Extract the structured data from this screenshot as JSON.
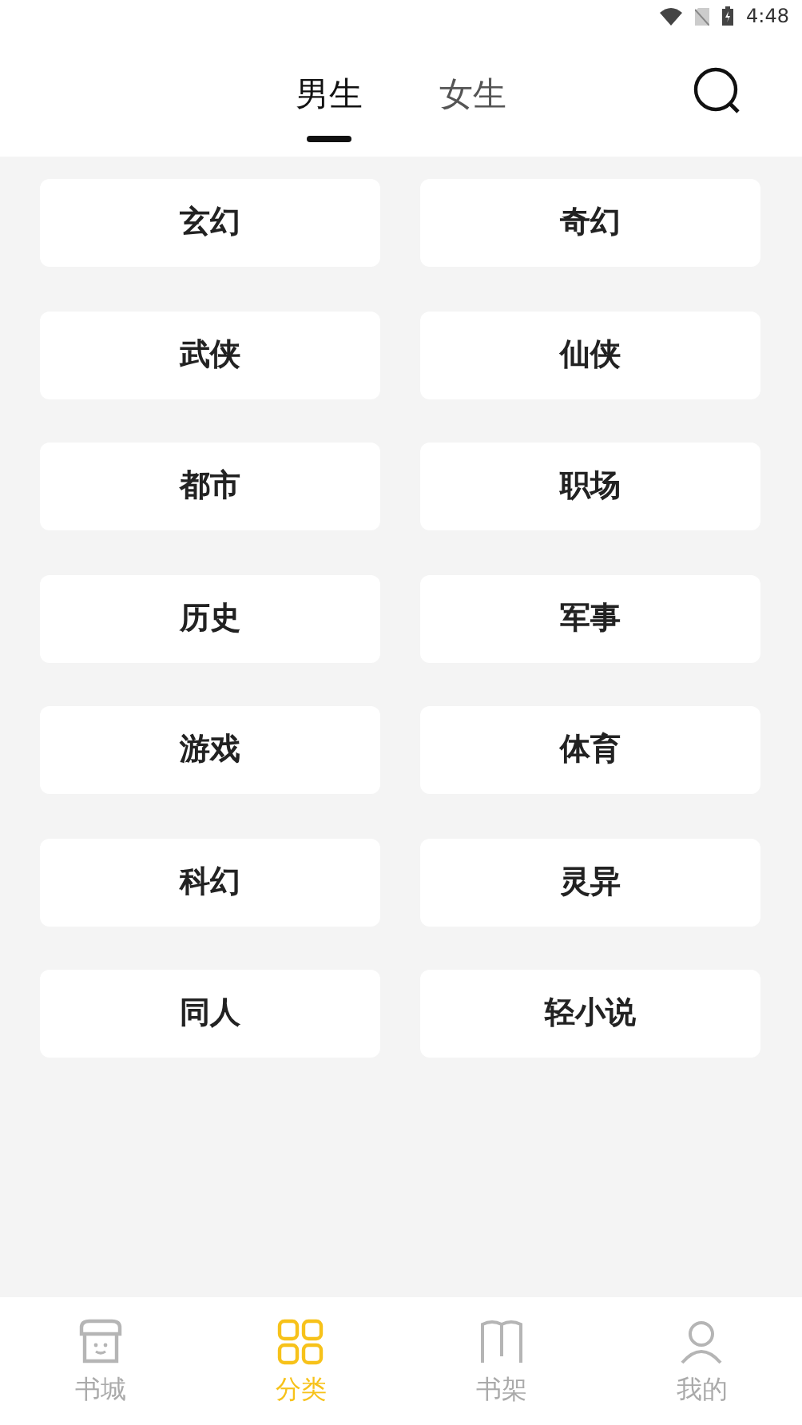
{
  "status_bar": {
    "time": "4:48"
  },
  "tabs": [
    {
      "label": "男生",
      "selected": true
    },
    {
      "label": "女生",
      "selected": false
    }
  ],
  "categories": [
    "玄幻",
    "奇幻",
    "武侠",
    "仙侠",
    "都市",
    "职场",
    "历史",
    "军事",
    "游戏",
    "体育",
    "科幻",
    "灵异",
    "同人",
    "轻小说"
  ],
  "bottom_nav": [
    {
      "label": "书城",
      "kind": "store",
      "selected": false
    },
    {
      "label": "分类",
      "kind": "grid",
      "selected": true
    },
    {
      "label": "书架",
      "kind": "book",
      "selected": false
    },
    {
      "label": "我的",
      "kind": "person",
      "selected": false
    }
  ]
}
